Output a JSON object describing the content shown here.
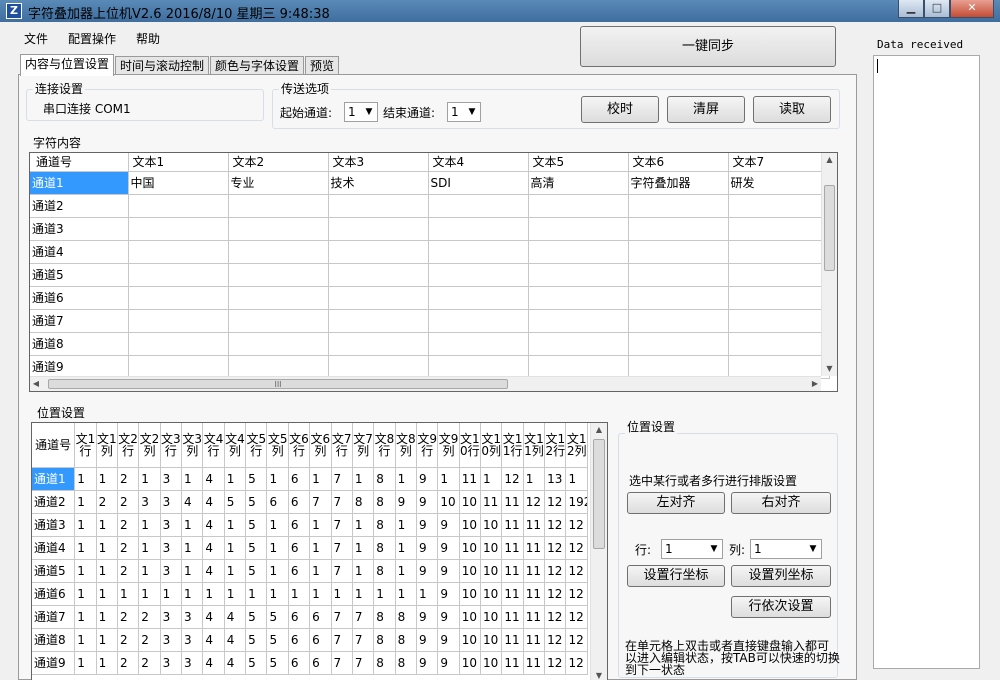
{
  "window": {
    "title": "字符叠加器上位机V2.6   2016/8/10 星期三 9:48:38",
    "icon": "app-logo-icon"
  },
  "menu": [
    "文件",
    "配置操作",
    "帮助"
  ],
  "tabs": [
    "内容与位置设置",
    "时间与滚动控制",
    "颜色与字体设置",
    "预览"
  ],
  "sync_button": "一键同步",
  "connection": {
    "group_title": "连接设置",
    "text": "串口连接  COM1"
  },
  "transfer": {
    "group_title": "传送选项",
    "start_label": "起始通道:",
    "start_value": "1",
    "end_label": "结束通道:",
    "end_value": "1"
  },
  "buttons": {
    "calibrate": "校时",
    "clear": "清屏",
    "read": "读取"
  },
  "content_grid": {
    "group_title": "字符内容",
    "headers": [
      "通道号",
      "文本1",
      "文本2",
      "文本3",
      "文本4",
      "文本5",
      "文本6",
      "文本7"
    ],
    "rows": [
      [
        "通道1",
        "中国",
        "专业",
        "技术",
        "SDI",
        "高清",
        "字符叠加器",
        "研发"
      ],
      [
        "通道2",
        "",
        "",
        "",
        "",
        "",
        "",
        ""
      ],
      [
        "通道3",
        "",
        "",
        "",
        "",
        "",
        "",
        ""
      ],
      [
        "通道4",
        "",
        "",
        "",
        "",
        "",
        "",
        ""
      ],
      [
        "通道5",
        "",
        "",
        "",
        "",
        "",
        "",
        ""
      ],
      [
        "通道6",
        "",
        "",
        "",
        "",
        "",
        "",
        ""
      ],
      [
        "通道7",
        "",
        "",
        "",
        "",
        "",
        "",
        ""
      ],
      [
        "通道8",
        "",
        "",
        "",
        "",
        "",
        "",
        ""
      ],
      [
        "通道9",
        "",
        "",
        "",
        "",
        "",
        "",
        ""
      ]
    ],
    "hscroll_grip": "III"
  },
  "position_grid": {
    "group_title": "位置设置",
    "headers": [
      "通道号",
      "文1行",
      "文1列",
      "文2行",
      "文2列",
      "文3行",
      "文3列",
      "文4行",
      "文4列",
      "文5行",
      "文5列",
      "文6行",
      "文6列",
      "文7行",
      "文7列",
      "文8行",
      "文8列",
      "文9行",
      "文9列",
      "文10行",
      "文10列",
      "文11行",
      "文11列",
      "文12行",
      "文12列"
    ],
    "rows": [
      [
        "通道1",
        "1",
        "1",
        "2",
        "1",
        "3",
        "1",
        "4",
        "1",
        "5",
        "1",
        "6",
        "1",
        "7",
        "1",
        "8",
        "1",
        "9",
        "1",
        "11",
        "1",
        "12",
        "1",
        "13",
        "1"
      ],
      [
        "通道2",
        "1",
        "2",
        "2",
        "3",
        "3",
        "4",
        "4",
        "5",
        "5",
        "6",
        "6",
        "7",
        "7",
        "8",
        "8",
        "9",
        "9",
        "10",
        "10",
        "11",
        "11",
        "12",
        "12",
        "192"
      ],
      [
        "通道3",
        "1",
        "1",
        "2",
        "1",
        "3",
        "1",
        "4",
        "1",
        "5",
        "1",
        "6",
        "1",
        "7",
        "1",
        "8",
        "1",
        "9",
        "9",
        "10",
        "10",
        "11",
        "11",
        "12",
        "12"
      ],
      [
        "通道4",
        "1",
        "1",
        "2",
        "1",
        "3",
        "1",
        "4",
        "1",
        "5",
        "1",
        "6",
        "1",
        "7",
        "1",
        "8",
        "1",
        "9",
        "9",
        "10",
        "10",
        "11",
        "11",
        "12",
        "12"
      ],
      [
        "通道5",
        "1",
        "1",
        "2",
        "1",
        "3",
        "1",
        "4",
        "1",
        "5",
        "1",
        "6",
        "1",
        "7",
        "1",
        "8",
        "1",
        "9",
        "9",
        "10",
        "10",
        "11",
        "11",
        "12",
        "12"
      ],
      [
        "通道6",
        "1",
        "1",
        "1",
        "1",
        "1",
        "1",
        "1",
        "1",
        "1",
        "1",
        "1",
        "1",
        "1",
        "1",
        "1",
        "1",
        "1",
        "9",
        "10",
        "10",
        "11",
        "11",
        "12",
        "12"
      ],
      [
        "通道7",
        "1",
        "1",
        "2",
        "2",
        "3",
        "3",
        "4",
        "4",
        "5",
        "5",
        "6",
        "6",
        "7",
        "7",
        "8",
        "8",
        "9",
        "9",
        "10",
        "10",
        "11",
        "11",
        "12",
        "12"
      ],
      [
        "通道8",
        "1",
        "1",
        "2",
        "2",
        "3",
        "3",
        "4",
        "4",
        "5",
        "5",
        "6",
        "6",
        "7",
        "7",
        "8",
        "8",
        "9",
        "9",
        "10",
        "10",
        "11",
        "11",
        "12",
        "12"
      ],
      [
        "通道9",
        "1",
        "1",
        "2",
        "2",
        "3",
        "3",
        "4",
        "4",
        "5",
        "5",
        "6",
        "6",
        "7",
        "7",
        "8",
        "8",
        "9",
        "9",
        "10",
        "10",
        "11",
        "11",
        "12",
        "12"
      ]
    ]
  },
  "layout_panel": {
    "group_title": "位置设置",
    "instruction": "选中某行或者多行进行排版设置",
    "left_align": "左对齐",
    "right_align": "右对齐",
    "row_label": "行:",
    "row_value": "1",
    "col_label": "列:",
    "col_value": "1",
    "set_row_coord": "设置行坐标",
    "set_col_coord": "设置列坐标",
    "row_sequence": "行依次设置",
    "hint": "在单元格上双击或者直接键盘输入都可以进入编辑状态，按TAB可以快速的切换到下一状态"
  },
  "data_received": {
    "label": "Data received"
  },
  "colors": {
    "selection": "#3399ff",
    "titlebar": "#4a7aab"
  }
}
